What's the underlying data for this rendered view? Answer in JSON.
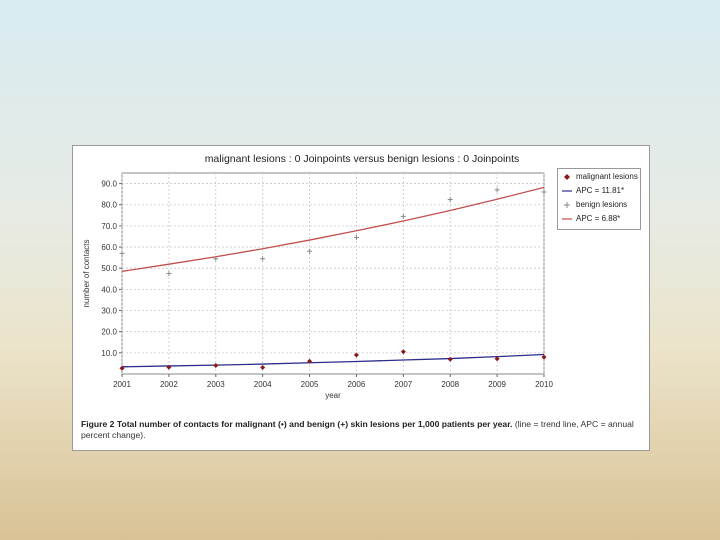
{
  "chart_data": {
    "type": "line",
    "title": "malignant lesions : 0 Joinpoints  versus  benign lesions : 0 Joinpoints",
    "xlabel": "year",
    "ylabel": "number of contacts",
    "x": [
      2001,
      2002,
      2003,
      2004,
      2005,
      2006,
      2007,
      2008,
      2009,
      2010
    ],
    "xlim": [
      2001,
      2010
    ],
    "ylim": [
      0,
      95
    ],
    "yticks": [
      "10.0",
      "20.0",
      "30.0",
      "40.0",
      "50.0",
      "60.0",
      "70.0",
      "80.0",
      "90.0"
    ],
    "xticks": [
      "2001",
      "2002",
      "2003",
      "2004",
      "2005",
      "2006",
      "2007",
      "2008",
      "2009",
      "2010"
    ],
    "grid": true,
    "legend_position": "top-right",
    "series": [
      {
        "name": "malignant lesions",
        "kind": "points",
        "marker": "diamond",
        "color": "#8b1a1a",
        "values": [
          2.7,
          3.2,
          4.0,
          3.1,
          6.0,
          9.0,
          10.5,
          7.0,
          7.2,
          8.0
        ]
      },
      {
        "name": "APC = 11.81*",
        "kind": "trend",
        "color": "#2c2c8c",
        "values": [
          3.4,
          3.8,
          4.2,
          4.7,
          5.3,
          5.9,
          6.6,
          7.3,
          8.2,
          9.2
        ]
      },
      {
        "name": "benign lesions",
        "kind": "points",
        "marker": "plus",
        "color": "#8a8a8a",
        "values": [
          57.0,
          47.5,
          54.5,
          54.5,
          58.0,
          64.5,
          74.5,
          82.5,
          87.0,
          86.0
        ]
      },
      {
        "name": "APC = 6.88*",
        "kind": "trend",
        "color": "#c0504d",
        "values": [
          48.5,
          51.9,
          55.4,
          59.2,
          63.3,
          67.7,
          72.3,
          77.3,
          82.6,
          88.2
        ]
      }
    ]
  },
  "caption": {
    "label": "Figure 2",
    "bold_text": "Total number of contacts for malignant (•) and benign (+) skin lesions per 1,000 patients per year.",
    "normal_text": "(line = trend line, APC = annual percent change)."
  }
}
